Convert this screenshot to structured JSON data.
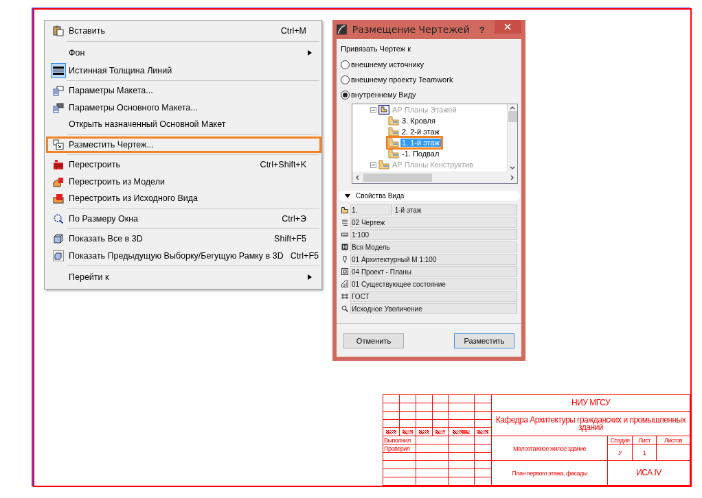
{
  "menu": {
    "groups": [
      [
        {
          "label": "Вставить",
          "shortcut": "Ctrl+M",
          "submenu": false,
          "checked": false,
          "highlighted": false
        }
      ],
      [
        {
          "label": "Фон",
          "submenu": true,
          "checked": false,
          "highlighted": false
        },
        {
          "label": "Истинная Толщина Линий",
          "submenu": false,
          "checked": true,
          "highlighted": false
        }
      ],
      [
        {
          "label": "Параметры Макета...",
          "submenu": false,
          "checked": false,
          "highlighted": false
        },
        {
          "label": "Параметры Основного Макета...",
          "submenu": false,
          "checked": false,
          "highlighted": false
        },
        {
          "label": "Открыть назначенный Основной Макет",
          "submenu": false,
          "checked": false,
          "highlighted": false
        }
      ],
      [
        {
          "label": "Разместить Чертеж...",
          "submenu": false,
          "checked": false,
          "highlighted": true
        }
      ],
      [
        {
          "label": "Перестроить",
          "shortcut": "Ctrl+Shift+K",
          "submenu": false,
          "checked": false,
          "highlighted": false
        },
        {
          "label": "Перестроить из Модели",
          "submenu": false,
          "checked": false,
          "highlighted": false
        },
        {
          "label": "Перестроить из Исходного Вида",
          "submenu": false,
          "checked": false,
          "highlighted": false
        }
      ],
      [
        {
          "label": "По Размеру Окна",
          "shortcut": "Ctrl+Э",
          "submenu": false,
          "checked": false,
          "highlighted": false
        }
      ],
      [
        {
          "label": "Показать Все в 3D",
          "shortcut": "Shift+F5",
          "submenu": false,
          "checked": false,
          "highlighted": false
        },
        {
          "label": "Показать Предыдущую Выборку/Бегущую Рамку в 3D",
          "shortcut": "Ctrl+F5",
          "submenu": false,
          "checked": false,
          "highlighted": false
        }
      ],
      [
        {
          "label": "Перейти к",
          "submenu": true,
          "checked": false,
          "highlighted": false
        }
      ]
    ]
  },
  "dialog": {
    "title": "Размещение Чертежей",
    "help": "?",
    "bind_label": "Привязать Чертеж  к",
    "radios": [
      {
        "label": "внешнему источнику",
        "selected": false
      },
      {
        "label": "внешнему проекту Teamwork",
        "selected": false
      },
      {
        "label": "внутреннему Виду",
        "selected": true
      }
    ],
    "tree": [
      {
        "label": "АР Планы Этажей",
        "dimmed": true,
        "expanded": true,
        "selected": false,
        "children": [
          {
            "label": "3. Кровля",
            "dimmed": false,
            "selected": false
          },
          {
            "label": "2. 2-й этаж",
            "dimmed": false,
            "selected": false
          },
          {
            "label": "1. 1-й этаж",
            "dimmed": false,
            "selected": true
          },
          {
            "label": "-1. Подвал",
            "dimmed": false,
            "selected": false
          }
        ]
      },
      {
        "label": "АР Планы Конструктив",
        "dimmed": true,
        "expanded": true,
        "selected": false
      }
    ],
    "properties": {
      "title": "Свойства Вида",
      "expanded": true,
      "rows": [
        {
          "values": [
            "1.",
            "1-й этаж"
          ]
        },
        {
          "values": [
            "02 Чертеж"
          ]
        },
        {
          "values": [
            "1:100"
          ]
        },
        {
          "values": [
            "Вся Модель"
          ]
        },
        {
          "values": [
            "01 Архитектурный М 1:100"
          ]
        },
        {
          "values": [
            "04 Проект - Планы"
          ]
        },
        {
          "values": [
            "01 Существующее состояние"
          ]
        },
        {
          "values": [
            "ГОСТ"
          ]
        },
        {
          "values": [
            "Исходное Увеличение"
          ]
        }
      ]
    },
    "buttons": [
      {
        "label": "Отменить",
        "default": false
      },
      {
        "label": "Разместить",
        "default": true
      }
    ]
  },
  "title_block": {
    "university": "НИУ МГСУ",
    "department": "Кафедра Архитектуры гражданских и промышленных зданий",
    "signatures": [
      "Выполнил",
      "Проверил"
    ],
    "project": "Малоэтажное жилое здание",
    "sheet_title": "План первого этажа, фасады",
    "stage_header": "Стадия",
    "sheet_header": "Лист",
    "sheets_header": "Листов",
    "stage": "У",
    "sheet": "1",
    "code": "ИСА IV"
  }
}
